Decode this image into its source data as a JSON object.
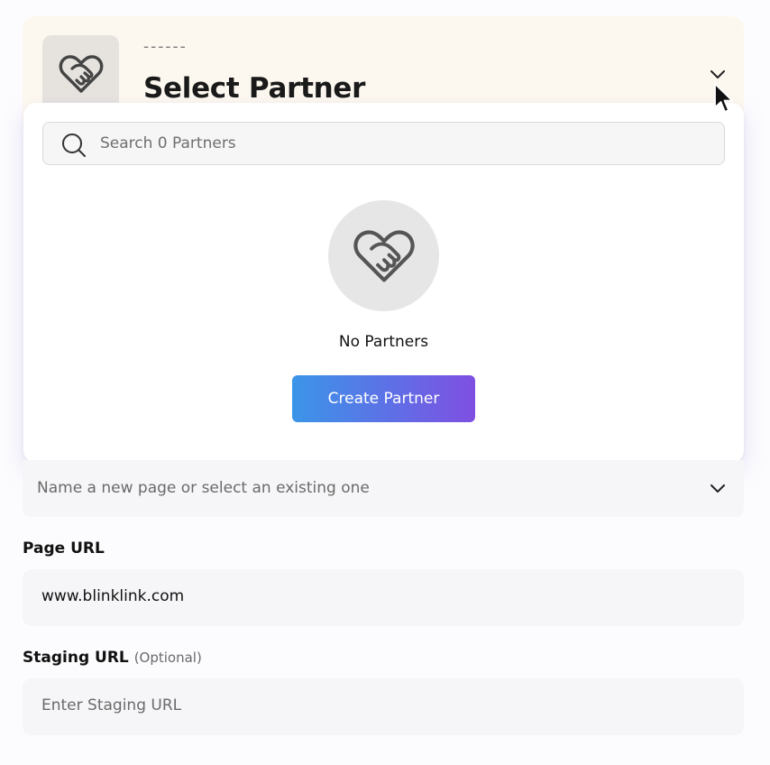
{
  "partner_card": {
    "placeholder_dashes": "------",
    "title": "Select Partner",
    "avatar_icon": "handshake-heart-icon",
    "toggle_icon": "chevron-down-icon",
    "background": "#fdf8ef"
  },
  "partner_dropdown": {
    "search_placeholder": "Search 0 Partners",
    "search_icon": "search-icon",
    "empty_icon": "handshake-heart-icon",
    "empty_text": "No Partners",
    "create_button_label": "Create Partner",
    "button_gradient": [
      "#3b95e8",
      "#7f4fe2"
    ]
  },
  "page_select": {
    "placeholder": "Name a new page or select an existing one",
    "toggle_icon": "chevron-down-icon"
  },
  "page_url": {
    "label": "Page URL",
    "value": "www.blinklink.com"
  },
  "staging_url": {
    "label": "Staging URL",
    "optional_note": "(Optional)",
    "placeholder": "Enter Staging URL"
  }
}
